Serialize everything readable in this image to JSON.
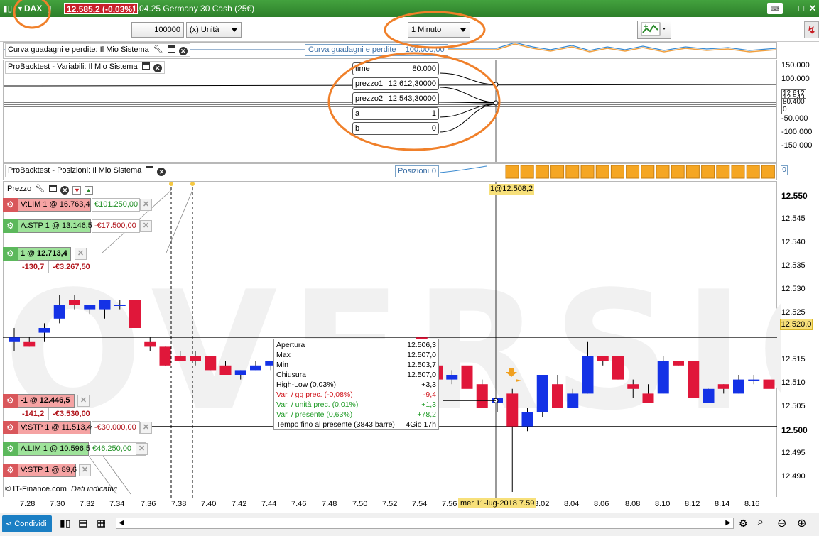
{
  "titlebar": {
    "symbol": "DAX",
    "price_change": "12.585,2 (-0,03%)",
    "instrument": "1.04.25 Germany 30 Cash (25€)"
  },
  "toolbar": {
    "quantity_value": "100000",
    "unit_select": "(x) Unità",
    "timeframe_select": "1 Minuto"
  },
  "equity_panel": {
    "label": "Curva guadagni e perdite: Il Mio Sistema",
    "inline_label": "Curva guadagni e perdite",
    "inline_value": "100.000,00"
  },
  "variables_panel": {
    "label": "ProBacktest - Variabili: Il Mio Sistema",
    "variables": [
      {
        "name": "time",
        "value": "80.000"
      },
      {
        "name": "prezzo1",
        "value": "12.612,30000"
      },
      {
        "name": "prezzo2",
        "value": "12.543,30000"
      },
      {
        "name": "a",
        "value": "1"
      },
      {
        "name": "b",
        "value": "0"
      }
    ],
    "axis_labels": [
      "150.000",
      "100.000",
      "50.000",
      "-50.000",
      "-100.000",
      "-150.000"
    ],
    "axis_badges": [
      "12.612",
      "12.543",
      "80.400",
      "0"
    ]
  },
  "positions_panel": {
    "label": "ProBacktest - Posizioni: Il Mio Sistema",
    "inline_label": "Posizioni",
    "inline_value": "0",
    "axis_badge": "0"
  },
  "price_panel": {
    "label": "Prezzo",
    "crosshair_label": "1@12.508,2",
    "crosshair_price": "12.520,0",
    "axis_labels": [
      "12.550",
      "12.545",
      "12.540",
      "12.535",
      "12.530",
      "12.525",
      "12.515",
      "12.510",
      "12.505",
      "12.500",
      "12.495",
      "12.490"
    ],
    "watermark": "OVERSIO",
    "copyright": "© IT-Finance.com",
    "copyright_note": "Dati indicativi"
  },
  "orders": [
    {
      "label": "V:LIM  1 @ 16.763,4",
      "amount": "€101.250,00",
      "color": "red",
      "amount_color": "green"
    },
    {
      "label": "A:STP  1 @ 13.146,5",
      "amount": "-€17.500,00",
      "color": "green",
      "amount_color": "red"
    },
    {
      "label": "1 @ 12.713,4",
      "amount": "",
      "color": "green",
      "sub_points": "-130,7",
      "sub_amount": "-€3.267,50"
    },
    {
      "label": "-1 @ 12.446,5",
      "amount": "",
      "color": "red",
      "sub_points": "-141,2",
      "sub_amount": "-€3.530,00"
    },
    {
      "label": "V:STP  1 @ 11.513,4",
      "amount": "-€30.000,00",
      "color": "red",
      "amount_color": "red"
    },
    {
      "label": "A:LIM  1 @ 10.596,5",
      "amount": "€46.250,00",
      "color": "green",
      "amount_color": "green"
    },
    {
      "label": "V:STP  1 @ 89,6",
      "amount": "",
      "color": "red"
    }
  ],
  "tooltip": {
    "rows": [
      {
        "k": "Apertura",
        "v": "12.506,3",
        "style": "black"
      },
      {
        "k": "Max",
        "v": "12.507,0",
        "style": "black"
      },
      {
        "k": "Min",
        "v": "12.503,7",
        "style": "black"
      },
      {
        "k": "Chiusura",
        "v": "12.507,0",
        "style": "black"
      },
      {
        "k": "High-Low (0,03%)",
        "v": "+3,3",
        "style": "black"
      },
      {
        "k": "Var. / gg prec. (-0,08%)",
        "v": "-9,4",
        "style": "red"
      },
      {
        "k": "Var. / unità prec. (0,01%)",
        "v": "+1,3",
        "style": "green"
      },
      {
        "k": "Var. / presente (0,63%)",
        "v": "+78,2",
        "style": "green"
      },
      {
        "k": "Tempo fino al presente (3843 barre)",
        "v": "4Gio 17h",
        "style": "black"
      }
    ]
  },
  "xaxis": {
    "labels": [
      "7.28",
      "7.30",
      "7.32",
      "7.34",
      "7.36",
      "7.38",
      "7.40",
      "7.42",
      "7.44",
      "7.46",
      "7.48",
      "7.50",
      "7.52",
      "7.54",
      "7.56",
      "8.02",
      "8.04",
      "8.06",
      "8.08",
      "8.10",
      "8.12",
      "8.14",
      "8.16"
    ],
    "cursor_label": "mer 11-lug-2018 7.59"
  },
  "bottombar": {
    "share_label": "Condividi"
  },
  "colors": {
    "titlebar": "#3a9a36",
    "bull": "#1432e6",
    "bear": "#e0173a",
    "position_bar": "#f5a623",
    "annotation": "#f0802a"
  },
  "chart_data": {
    "type": "candlestick",
    "ylim": [
      12487,
      12552
    ],
    "ohlc": [
      {
        "o": 12519,
        "h": 12522,
        "l": 12517,
        "c": 12520
      },
      {
        "o": 12519,
        "h": 12520,
        "l": 12518,
        "c": 12518
      },
      {
        "o": 12521,
        "h": 12523,
        "l": 12519,
        "c": 12522
      },
      {
        "o": 12524,
        "h": 12529,
        "l": 12523,
        "c": 12527
      },
      {
        "o": 12528,
        "h": 12529,
        "l": 12526,
        "c": 12527
      },
      {
        "o": 12526,
        "h": 12527,
        "l": 12525,
        "c": 12527
      },
      {
        "o": 12526,
        "h": 12528,
        "l": 12524,
        "c": 12528
      },
      {
        "o": 12527,
        "h": 12528,
        "l": 12526,
        "c": 12527
      },
      {
        "o": 12528,
        "h": 12528,
        "l": 12522,
        "c": 12522
      },
      {
        "o": 12519,
        "h": 12520,
        "l": 12517,
        "c": 12518
      },
      {
        "o": 12518,
        "h": 12518,
        "l": 12514,
        "c": 12514
      },
      {
        "o": 12516,
        "h": 12517,
        "l": 12515,
        "c": 12515
      },
      {
        "o": 12516,
        "h": 12517,
        "l": 12514,
        "c": 12515
      },
      {
        "o": 12516,
        "h": 12516,
        "l": 12513,
        "c": 12513
      },
      {
        "o": 12514,
        "h": 12515,
        "l": 12512,
        "c": 12512
      },
      {
        "o": 12512,
        "h": 12513,
        "l": 12511,
        "c": 12513
      },
      {
        "o": 12513,
        "h": 12515,
        "l": 12513,
        "c": 12514
      },
      {
        "o": 12514,
        "h": 12515,
        "l": 12513,
        "c": 12515
      },
      {
        "o": 12517,
        "h": 12518,
        "l": 12516,
        "c": 12518
      },
      {
        "o": 12518,
        "h": 12518,
        "l": 12516,
        "c": 12517
      },
      {
        "o": 12517,
        "h": 12517,
        "l": 12516,
        "c": 12516
      },
      {
        "o": 12517,
        "h": 12517,
        "l": 12516,
        "c": 12516
      },
      {
        "o": 12516,
        "h": 12516,
        "l": 12512,
        "c": 12513
      },
      {
        "o": 12514,
        "h": 12516,
        "l": 12512,
        "c": 12516
      },
      {
        "o": 12518,
        "h": 12519,
        "l": 12517,
        "c": 12517
      },
      {
        "o": 12517,
        "h": 12518,
        "l": 12516,
        "c": 12517
      },
      {
        "o": 12516,
        "h": 12518,
        "l": 12516,
        "c": 12518
      },
      {
        "o": 12520,
        "h": 12520,
        "l": 12516,
        "c": 12516
      },
      {
        "o": 12514,
        "h": 12515,
        "l": 12511,
        "c": 12511
      },
      {
        "o": 12511,
        "h": 12513,
        "l": 12510,
        "c": 12512
      },
      {
        "o": 12514,
        "h": 12515,
        "l": 12509,
        "c": 12509
      },
      {
        "o": 12510,
        "h": 12511,
        "l": 12505,
        "c": 12505
      },
      {
        "o": 12506,
        "h": 12507,
        "l": 12504,
        "c": 12507
      },
      {
        "o": 12508,
        "h": 12509,
        "l": 12487,
        "c": 12501
      },
      {
        "o": 12501,
        "h": 12505,
        "l": 12500,
        "c": 12504
      },
      {
        "o": 12504,
        "h": 12512,
        "l": 12503,
        "c": 12512
      },
      {
        "o": 12510,
        "h": 12512,
        "l": 12505,
        "c": 12505
      },
      {
        "o": 12505,
        "h": 12509,
        "l": 12505,
        "c": 12508
      },
      {
        "o": 12508,
        "h": 12519,
        "l": 12508,
        "c": 12516
      },
      {
        "o": 12516,
        "h": 12516,
        "l": 12514,
        "c": 12515
      },
      {
        "o": 12516,
        "h": 12516,
        "l": 12511,
        "c": 12511
      },
      {
        "o": 12510,
        "h": 12511,
        "l": 12507,
        "c": 12509
      },
      {
        "o": 12508,
        "h": 12510,
        "l": 12506,
        "c": 12506
      },
      {
        "o": 12508,
        "h": 12516,
        "l": 12508,
        "c": 12515
      },
      {
        "o": 12515,
        "h": 12515,
        "l": 12514,
        "c": 12514
      },
      {
        "o": 12515,
        "h": 12515,
        "l": 12507,
        "c": 12507
      },
      {
        "o": 12506,
        "h": 12509,
        "l": 12506,
        "c": 12509
      },
      {
        "o": 12510,
        "h": 12510,
        "l": 12508,
        "c": 12509
      },
      {
        "o": 12508,
        "h": 12512,
        "l": 12508,
        "c": 12511
      },
      {
        "o": 12511,
        "h": 12512,
        "l": 12510,
        "c": 12511
      },
      {
        "o": 12511,
        "h": 12512,
        "l": 12509,
        "c": 12509
      }
    ]
  }
}
